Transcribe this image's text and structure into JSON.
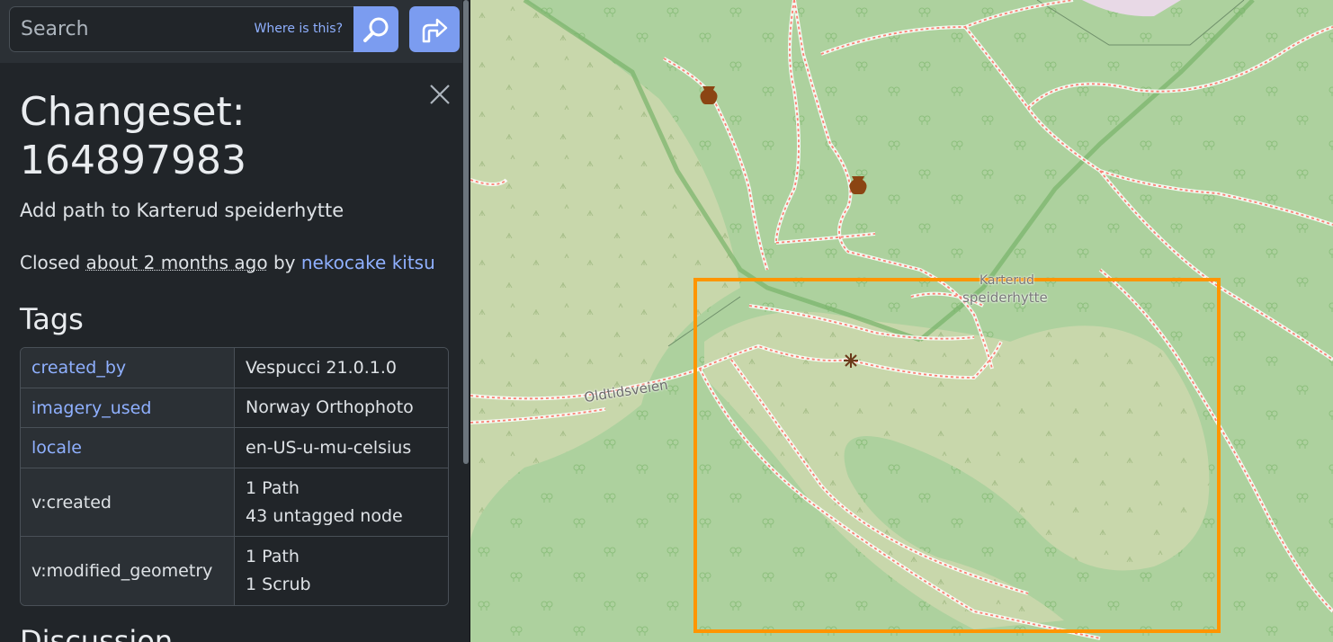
{
  "search": {
    "placeholder": "Search",
    "where_label": "Where is this?"
  },
  "changeset": {
    "title_prefix": "Changeset:",
    "id": "164897983",
    "comment": "Add path to Karterud speiderhytte",
    "closed_word": "Closed",
    "closed_time": "about 2 months ago",
    "by_word": "by",
    "user": "nekocake kitsu"
  },
  "tags_heading": "Tags",
  "tags": [
    {
      "key": "created_by",
      "value": "Vespucci 21.0.1.0"
    },
    {
      "key": "imagery_used",
      "value": "Norway Orthophoto"
    },
    {
      "key": "locale",
      "value": "en-US-u-mu-celsius"
    },
    {
      "key": "v:created",
      "value_line1": "1 Path",
      "value_line2": "43 untagged node"
    },
    {
      "key": "v:modified_geometry",
      "value_line1": "1 Path",
      "value_line2": "1 Scrub"
    }
  ],
  "discussion_heading": "Discussion",
  "map": {
    "labels": {
      "road": "Oldtidsveien",
      "hut_line1": "Karterud",
      "hut_line2": "speiderhytte"
    },
    "colors": {
      "forest": "#add19e",
      "scrub": "#c8d7ab",
      "path": "#fa8072",
      "highlight": "#ff9500",
      "boundary": "#78b46a"
    }
  },
  "icons": {
    "search": "search-icon",
    "directions": "directions-icon",
    "close": "close-icon",
    "archaeological": "amphora-icon",
    "viewpoint": "asterisk-icon"
  }
}
